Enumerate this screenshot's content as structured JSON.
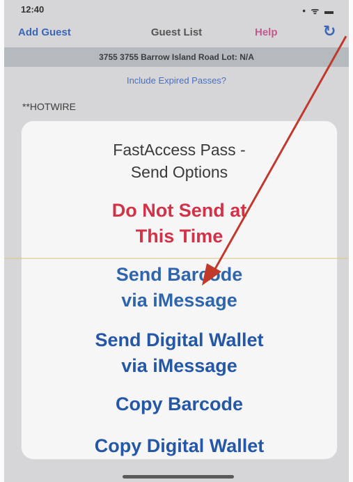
{
  "status_bar": {
    "time": "12:40",
    "icons": "•  ᯤ  ▬"
  },
  "nav": {
    "left_label": "Add Guest",
    "title": "Guest List",
    "help_label": "Help",
    "refresh_icon": "refresh-icon"
  },
  "address_bar": {
    "text": "3755 3755 Barrow Island Road Lot: N/A"
  },
  "expired_toggle": {
    "label": "Include Expired Passes?"
  },
  "background_list": {
    "first_item": "**HOTWIRE"
  },
  "action_sheet": {
    "title": "FastAccess Pass -\nSend Options",
    "options": [
      {
        "label": "Do Not Send at\nThis Time",
        "color": "#d23148"
      },
      {
        "label": "Send Barcode\nvia iMessage",
        "color": "#2f65ad"
      },
      {
        "label": "Send Digital Wallet\nvia iMessage",
        "color": "#2557a7"
      },
      {
        "label": "Copy Barcode",
        "color": "#2557a7"
      },
      {
        "label": "Copy Digital Wallet",
        "color": "#2557a7"
      }
    ]
  },
  "annotation": {
    "arrow_color": "#c0392b"
  }
}
